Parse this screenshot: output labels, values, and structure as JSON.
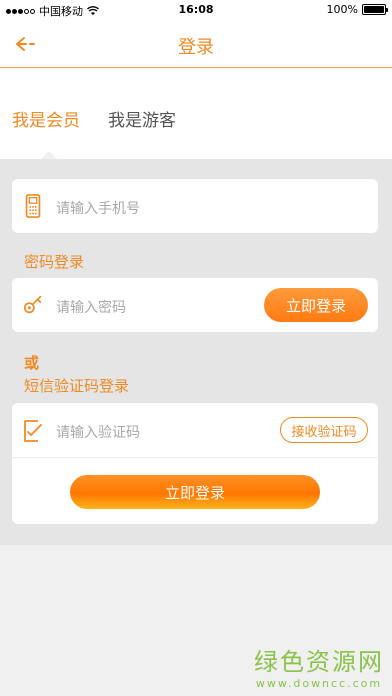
{
  "status_bar": {
    "carrier": "中国移动",
    "time": "16:08",
    "battery": "100%",
    "battery_level": 1.0
  },
  "header": {
    "title": "登录",
    "back_icon": "arrow-left-icon"
  },
  "tabs": [
    {
      "label": "我是会员",
      "active": true
    },
    {
      "label": "我是游客",
      "active": false
    }
  ],
  "phone": {
    "placeholder": "请输入手机号",
    "icon": "phone-icon"
  },
  "password_section": {
    "label": "密码登录",
    "placeholder": "请输入密码",
    "icon": "key-icon",
    "login_button": "立即登录"
  },
  "or_label": "或",
  "sms_section": {
    "label": "短信验证码登录",
    "placeholder": "请输入验证码",
    "icon": "checklist-icon",
    "get_code_button": "接收验证码",
    "login_button": "立即登录"
  },
  "watermark": {
    "title": "绿色资源网",
    "url": "www.downcc.com"
  },
  "colors": {
    "accent": "#f08a24",
    "button_gradient_top": "#ff9a3a",
    "button_gradient_bottom": "#ff7a12",
    "placeholder": "#a8a8a8",
    "watermark": "#8ac34a"
  }
}
